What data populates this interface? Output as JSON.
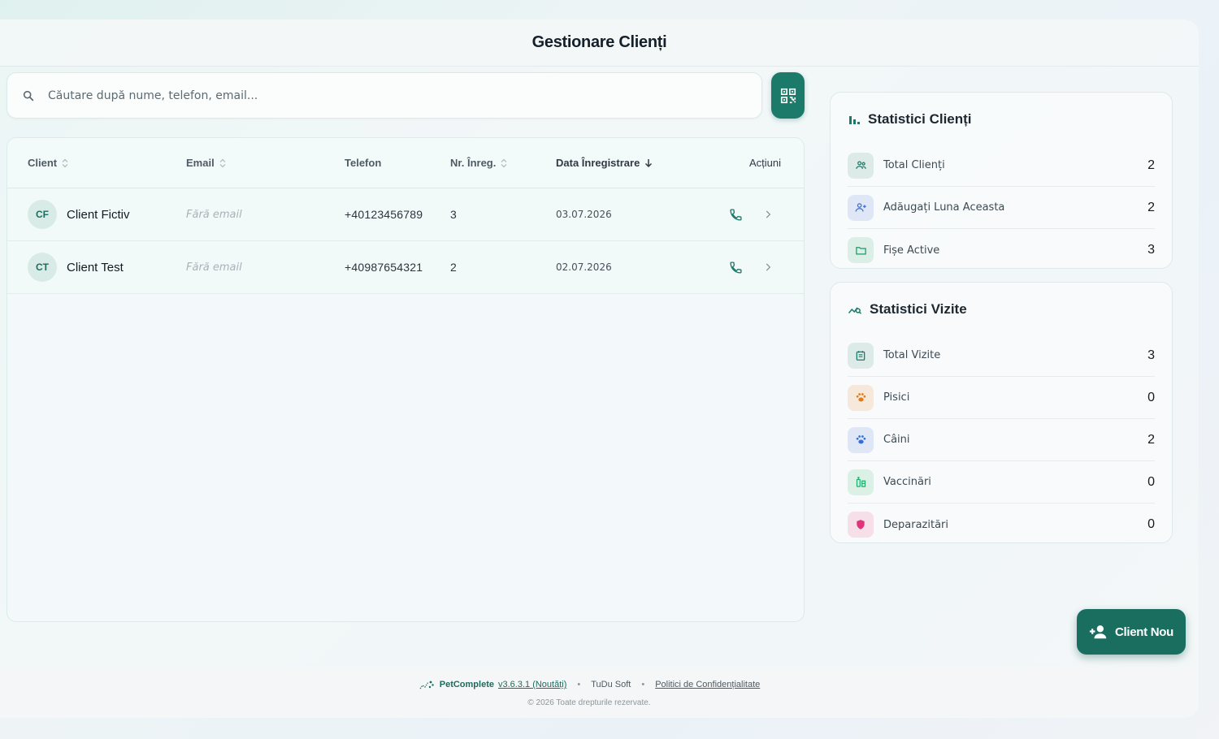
{
  "header": {
    "title": "Gestionare Clienți"
  },
  "search": {
    "placeholder": "Căutare după nume, telefon, email..."
  },
  "table": {
    "columns": {
      "client": "Client",
      "email": "Email",
      "phone": "Telefon",
      "reg_count": "Nr. Înreg.",
      "reg_date": "Data Înregistrare",
      "actions": "Acțiuni"
    },
    "rows": [
      {
        "initials": "CF",
        "name": "Client Fictiv",
        "email": "Fără email",
        "phone": "+40123456789",
        "count": "3",
        "date": "03.07.2026"
      },
      {
        "initials": "CT",
        "name": "Client Test",
        "email": "Fără email",
        "phone": "+40987654321",
        "count": "2",
        "date": "02.07.2026"
      }
    ]
  },
  "client_stats": {
    "title": "Statistici Clienți",
    "items": [
      {
        "label": "Total Clienți",
        "value": "2",
        "icon": "people-icon",
        "color": "#1c7a6a"
      },
      {
        "label": "Adăugați Luna Aceasta",
        "value": "2",
        "icon": "person-add-icon",
        "color": "#3b6fd8"
      },
      {
        "label": "Fișe Active",
        "value": "3",
        "icon": "folder-icon",
        "color": "#1c9a6a"
      }
    ]
  },
  "visit_stats": {
    "title": "Statistici Vizite",
    "items": [
      {
        "label": "Total Vizite",
        "value": "3",
        "icon": "calendar-icon",
        "color": "#1c7a6a"
      },
      {
        "label": "Pisici",
        "value": "0",
        "icon": "paw-icon",
        "color": "#e07c16"
      },
      {
        "label": "Câini",
        "value": "2",
        "icon": "paw-icon",
        "color": "#2f6fe0"
      },
      {
        "label": "Vaccinări",
        "value": "0",
        "icon": "vaccine-icon",
        "color": "#1fae6e"
      },
      {
        "label": "Deparazitări",
        "value": "0",
        "icon": "shield-icon",
        "color": "#e0347a"
      }
    ]
  },
  "fab": {
    "label": "Client Nou"
  },
  "footer": {
    "brand": "PetComplete",
    "version": "v3.6.3.1 (Noutăți)",
    "company": "TuDu Soft",
    "policy": "Politici de Confidențialitate",
    "copyright": "© 2026 Toate drepturile rezervate."
  },
  "colors": {
    "accent": "#1c7a6a",
    "accent_dark": "#1a6e60"
  }
}
